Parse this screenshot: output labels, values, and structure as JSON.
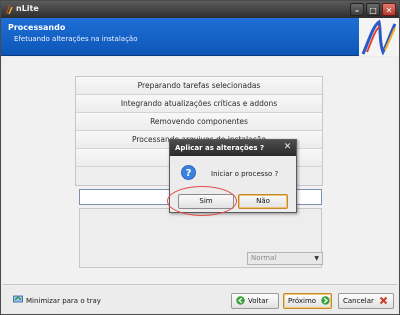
{
  "window": {
    "title": "nLite"
  },
  "header": {
    "title": "Processando",
    "subtitle": "Efetuando alterações na instalação"
  },
  "tasks": [
    "Preparando tarefas selecionadas",
    "Integrando atualizações críticas e addons",
    "Removendo componentes",
    "Processando arquivos de instalação"
  ],
  "priority": {
    "selected": "Normal"
  },
  "dialog": {
    "title": "Aplicar as alterações ?",
    "message": "Iniciar o processo ?",
    "yes_label": "Sim",
    "no_label": "Não",
    "close_glyph": "✕"
  },
  "footer": {
    "tray_label": "Minimizar para o tray",
    "back_label": "Voltar",
    "next_label": "Próximo",
    "cancel_label": "Cancelar"
  },
  "colors": {
    "header_blue": "#1e6fd6",
    "highlight_ring": "#e05050",
    "default_button_border": "#c48a2e"
  },
  "icons": [
    "nlite-app-icon",
    "minimize-icon",
    "maximize-icon",
    "close-icon",
    "nlite-logo",
    "question-icon",
    "tray-icon",
    "back-arrow-icon",
    "next-arrow-icon",
    "cancel-x-icon",
    "chevron-down-icon"
  ]
}
